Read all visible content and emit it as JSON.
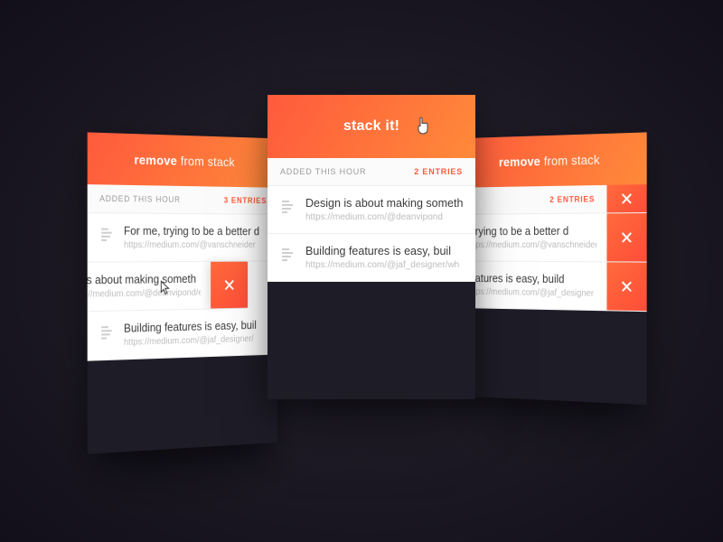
{
  "left": {
    "header_bold": "remove",
    "header_light": " from stack",
    "sub_label": "ADDED THIS HOUR",
    "sub_count": "3 ENTRIES",
    "rows": [
      {
        "title": "For me, trying to be a better d",
        "url": "https://medium.com/@vanschneider"
      },
      {
        "title": "ign is about making someth",
        "url": "https://medium.com/@deanvipond/ex"
      },
      {
        "title": "Building features is easy, buil",
        "url": "https://medium.com/@jaf_designer/"
      }
    ]
  },
  "center": {
    "header_bold": "stack",
    "header_light": " it!",
    "sub_label": "ADDED THIS HOUR",
    "sub_count": "2 ENTRIES",
    "rows": [
      {
        "title": "Design is about making someth",
        "url": "https://medium.com/@deanvipond"
      },
      {
        "title": "Building features is easy, buil",
        "url": "https://medium.com/@jaf_designer/wh"
      }
    ]
  },
  "right": {
    "header_bold": "remove",
    "header_light": " from stack",
    "sub_label": "",
    "sub_count": "2 ENTRIES",
    "rows": [
      {
        "title": ", trying to be a better d",
        "url": "https://medium.com/@vanschneider"
      },
      {
        "title": "features is easy, build",
        "url": "https://medium.com/@jaf_designer"
      }
    ]
  }
}
